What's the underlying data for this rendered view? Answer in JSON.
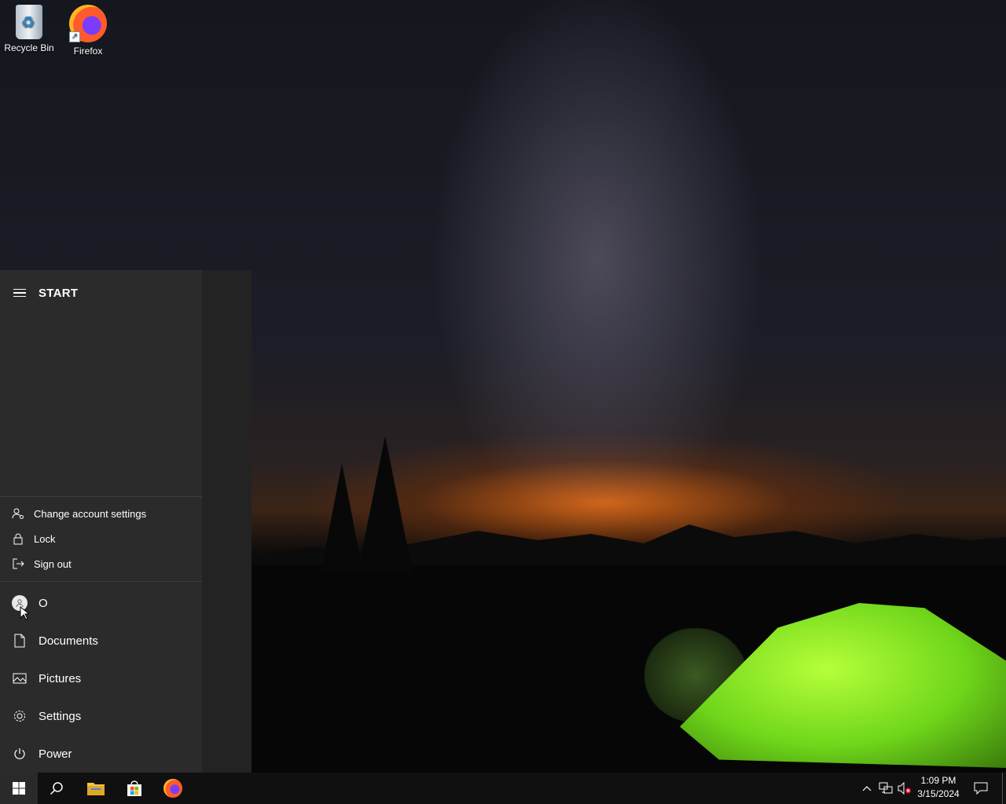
{
  "desktop": {
    "icons": [
      {
        "label": "Recycle Bin",
        "icon": "recycle-bin-icon"
      },
      {
        "label": "Firefox",
        "icon": "firefox-icon"
      }
    ]
  },
  "start_menu": {
    "title": "START",
    "account_flyout": [
      {
        "label": "Change account settings",
        "icon": "account-settings-icon"
      },
      {
        "label": "Lock",
        "icon": "lock-icon"
      },
      {
        "label": "Sign out",
        "icon": "sign-out-icon"
      }
    ],
    "user": {
      "name": "O",
      "icon": "user-avatar-icon"
    },
    "nav": [
      {
        "label": "Documents",
        "icon": "document-icon"
      },
      {
        "label": "Pictures",
        "icon": "pictures-icon"
      },
      {
        "label": "Settings",
        "icon": "gear-icon"
      },
      {
        "label": "Power",
        "icon": "power-icon"
      }
    ]
  },
  "taskbar": {
    "pinned": [
      "start-icon",
      "search-icon",
      "file-explorer-icon",
      "microsoft-store-icon",
      "firefox-icon"
    ],
    "tray": [
      "chevron-up-icon",
      "network-icon",
      "volume-muted-icon"
    ],
    "clock": {
      "time": "1:09 PM",
      "date": "3/15/2024"
    }
  },
  "colors": {
    "start_bg": "#2b2b2b",
    "taskbar_bg": "#101010",
    "accent_windows": "#ffffff"
  }
}
